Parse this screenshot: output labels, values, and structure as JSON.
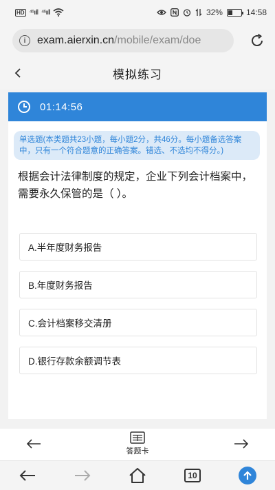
{
  "status_bar": {
    "hd_badge": "HD",
    "signal_1": "⁴⁶ııll",
    "signal_2": "⁴⁶ııll",
    "battery_percent": "32%",
    "battery_level": 0.32,
    "time": "14:58"
  },
  "browser": {
    "url_domain": "exam.aierxin.cn",
    "url_path": "/mobile/exam/doe",
    "tabs_count": "10"
  },
  "header": {
    "title": "模拟练习"
  },
  "timer": {
    "value": "01:14:56"
  },
  "notice": {
    "text": "单选题(本类题共23小题，每小题2分，共46分。每小题备选答案中，只有一个符合题意的正确答案。错选、不选均不得分。)"
  },
  "question": {
    "text": "根据会计法律制度的规定，企业下列会计档案中，需要永久保管的是（ ）。",
    "options": [
      "A.半年度财务报告",
      "B.年度财务报告",
      "C.会计档案移交清册",
      "D.银行存款余额调节表"
    ]
  },
  "footer": {
    "answer_card_label": "答题卡"
  },
  "colors": {
    "accent": "#2f85d9",
    "notice_bg": "#dceaf8"
  }
}
